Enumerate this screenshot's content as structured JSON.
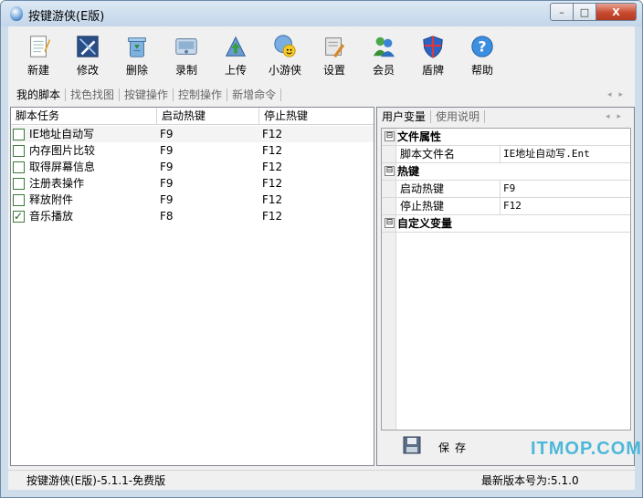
{
  "window": {
    "title": "按键游侠(E版)",
    "close_glyph": "X",
    "min_glyph": "–",
    "max_glyph": "□"
  },
  "toolbar": {
    "items": [
      {
        "label": "新建",
        "icon": "notepad-icon"
      },
      {
        "label": "修改",
        "icon": "edit-icon"
      },
      {
        "label": "删除",
        "icon": "recycle-bin-icon"
      },
      {
        "label": "录制",
        "icon": "record-icon"
      },
      {
        "label": "上传",
        "icon": "upload-icon"
      },
      {
        "label": "小游侠",
        "icon": "smiley-icon"
      },
      {
        "label": "设置",
        "icon": "settings-icon"
      },
      {
        "label": "会员",
        "icon": "members-icon"
      },
      {
        "label": "盾牌",
        "icon": "shield-icon"
      },
      {
        "label": "帮助",
        "icon": "help-icon"
      }
    ]
  },
  "tabs": [
    {
      "label": "我的脚本",
      "active": true
    },
    {
      "label": "找色找图",
      "active": false
    },
    {
      "label": "按键操作",
      "active": false
    },
    {
      "label": "控制操作",
      "active": false
    },
    {
      "label": "新增命令",
      "active": false
    }
  ],
  "script_list": {
    "columns": [
      "脚本任务",
      "启动热键",
      "停止热键"
    ],
    "rows": [
      {
        "name": "IE地址自动写",
        "start": "F9",
        "stop": "F12",
        "checked": false
      },
      {
        "name": "内存图片比较",
        "start": "F9",
        "stop": "F12",
        "checked": false
      },
      {
        "name": "取得屏幕信息",
        "start": "F9",
        "stop": "F12",
        "checked": false
      },
      {
        "name": "注册表操作",
        "start": "F9",
        "stop": "F12",
        "checked": false
      },
      {
        "name": "释放附件",
        "start": "F9",
        "stop": "F12",
        "checked": false
      },
      {
        "name": "音乐播放",
        "start": "F8",
        "stop": "F12",
        "checked": true
      }
    ]
  },
  "right_tabs": [
    {
      "label": "用户变量",
      "active": true
    },
    {
      "label": "使用说明",
      "active": false
    }
  ],
  "properties": {
    "collapse_glyph": "⊟",
    "groups": [
      {
        "category": "文件属性",
        "items": [
          {
            "key": "脚本文件名",
            "value": "IE地址自动写.Ent"
          }
        ]
      },
      {
        "category": "热键",
        "items": [
          {
            "key": "启动热键",
            "value": "F9"
          },
          {
            "key": "停止热键",
            "value": "F12"
          }
        ]
      },
      {
        "category": "自定义变量",
        "items": []
      }
    ]
  },
  "save_button": {
    "label": "保存"
  },
  "status": {
    "left": "按键游侠(E版)-5.1.1-免费版",
    "right": "最新版本号为:5.1.0"
  },
  "watermark": {
    "text": "ITMOP.COM"
  },
  "colors": {
    "accent": "#1f5fa8",
    "watermark": "#3db3d8"
  }
}
